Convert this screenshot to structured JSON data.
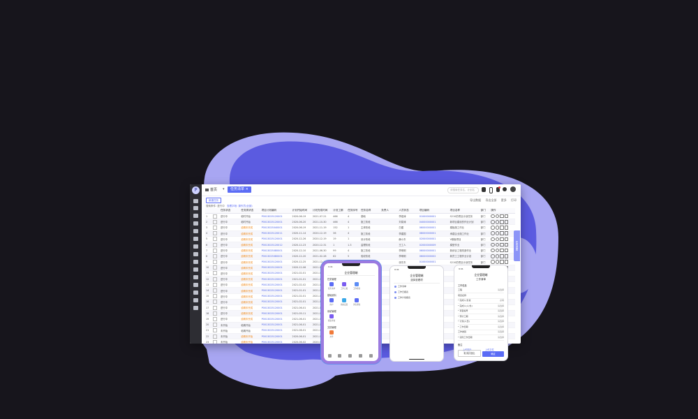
{
  "colors": {
    "accent": "#5b6cf5",
    "blob_dark": "#5b5be0",
    "blob_light": "#a8a6f2",
    "bg": "#17151c",
    "status_orange": "#f08a1a"
  },
  "desktop": {
    "home_tab": "首页",
    "active_tab": "任务清单 ×",
    "search_placeholder": "请搜索任务名、计划名",
    "toolbar_button": "新建任务",
    "toolbar_right": [
      "导出数据",
      "导出全部",
      "更多",
      "打印"
    ],
    "filter_text": "搜索条件: 进行中",
    "filter_text2": "查看字段: 操作员(全部)",
    "columns": [
      "",
      "",
      "任务状态",
      "任务类状态",
      "项目计划编码",
      "计划开始时间",
      "计划完成时间",
      "计划工期",
      "任务序号",
      "任务名称",
      "负责人",
      "人员状态",
      "项目编码",
      "项目名称",
      "部门",
      "操作"
    ],
    "rows": [
      [
        "1",
        "",
        "进行中",
        "临时开始",
        "P0013025120001",
        "2020-06-19",
        "2021-07-21",
        "466",
        "4",
        "基础",
        "",
        "李煜涛",
        "01000000001",
        "S210的项目计划任务",
        "部门"
      ],
      [
        "2",
        "",
        "进行中",
        "临时开始",
        "P0013025120001",
        "2020-06-20",
        "2021-10-30",
        "466",
        "4",
        "施工阶段",
        "",
        "刘易涛",
        "04000000001",
        "新项目建设的作业计划",
        "部门"
      ],
      [
        "3",
        "",
        "进行中",
        "逾期未完成",
        "P0013025040001",
        "2020-06-19",
        "2021-11-19",
        "152",
        "1",
        "主体阶段",
        "",
        "白建",
        "06000000001",
        "模板施工作业",
        "部门"
      ],
      [
        "4",
        "",
        "进行中",
        "逾期未完成",
        "P0013025120011",
        "2020-11-14",
        "2020-12-19",
        "36",
        "4",
        "施工阶段",
        "",
        "李建国",
        "08000000001",
        "承建企业施工作业",
        "部门"
      ],
      [
        "5",
        "",
        "进行中",
        "逾期未完成",
        "P0013025120001",
        "2020-12-26",
        "2020-12-19",
        "19",
        "1",
        "设计阶段",
        "",
        "薛小东",
        "02000000001",
        "V模板项目",
        "部门"
      ],
      [
        "6",
        "",
        "进行中",
        "逾期未完成",
        "P0013025120012",
        "2020-12-23",
        "2020-12-31",
        "1",
        "1.3",
        "监理阶段",
        "",
        "王工人",
        "02000000009",
        "模型作业",
        "部门"
      ],
      [
        "7",
        "",
        "进行中",
        "逾期未完成",
        "P0013025080001",
        "2020-12-10",
        "2021-06-30",
        "99",
        "4",
        "施工阶段",
        "",
        "李明明",
        "06000000001",
        "新综合工程改造作业",
        "部门"
      ],
      [
        "8",
        "",
        "进行中",
        "逾期未完成",
        "P0013025080001",
        "2020-12-20",
        "2021-02-28",
        "62",
        "5",
        "验收阶段",
        "",
        "李明明",
        "06000000002",
        "新员工工程作业计划",
        "部门"
      ],
      [
        "9",
        "",
        "进行中",
        "逾期未完成",
        "P0013025120001",
        "2020-12-25",
        "2021-12-31",
        "2",
        "3",
        "设计规划文档",
        "",
        "张东东",
        "01000000001",
        "S210的项目计划任务",
        "部门"
      ],
      [
        "10",
        "",
        "进行中",
        "逾期未完成",
        "P0013025120001",
        "2020-12-06",
        "2021-01-30",
        "",
        "",
        "",
        "",
        "",
        "",
        "",
        ""
      ],
      [
        "11",
        "",
        "进行中",
        "逾期未完成",
        "P0013025120001",
        "2021-02-01",
        "2021-04-30",
        "",
        "",
        "",
        "",
        "",
        "",
        "",
        ""
      ],
      [
        "12",
        "",
        "进行中",
        "逾期未完成",
        "P0013025120001",
        "2021-01-01",
        "2021-02-01",
        "",
        "",
        "",
        "",
        "",
        "",
        "",
        ""
      ],
      [
        "13",
        "",
        "进行中",
        "逾期未完成",
        "P0013025120001",
        "2021-02-02",
        "2021-02-03",
        "",
        "",
        "",
        "",
        "",
        "",
        "",
        ""
      ],
      [
        "14",
        "",
        "进行中",
        "逾期未完成",
        "P0013025120001",
        "2021-01-01",
        "2021-02-07",
        "",
        "",
        "",
        "",
        "",
        "",
        "",
        ""
      ],
      [
        "15",
        "",
        "进行中",
        "逾期未完成",
        "P0013025120001",
        "2021-02-01",
        "2021-04-03",
        "",
        "",
        "",
        "",
        "",
        "",
        "",
        ""
      ],
      [
        "16",
        "",
        "进行中",
        "逾期未完成",
        "P0013025120001",
        "2021-02-01",
        "2021-02-28",
        "",
        "",
        "",
        "",
        "",
        "",
        "",
        ""
      ],
      [
        "17",
        "",
        "进行中",
        "逾期未完成",
        "P0013025120001",
        "2021-06-01",
        "2021-06-03",
        "",
        "",
        "",
        "",
        "",
        "",
        "",
        ""
      ],
      [
        "18",
        "",
        "进行中",
        "逾期未完成",
        "P0013025120001",
        "2021-05-11",
        "2021-06-30",
        "",
        "",
        "",
        "",
        "",
        "",
        "",
        ""
      ],
      [
        "19",
        "",
        "进行中",
        "逾期未完成",
        "P0013025120001",
        "2021-06-01",
        "2021-06-15",
        "",
        "",
        "",
        "",
        "",
        "",
        "",
        ""
      ],
      [
        "20",
        "",
        "未开始",
        "临期开始",
        "P0013025120001",
        "2021-06-01",
        "2021-06-30",
        "",
        "",
        "",
        "",
        "",
        "",
        "",
        ""
      ],
      [
        "21",
        "",
        "未开始",
        "临期开始",
        "P0013025120001",
        "2021-06-01",
        "2021-07-31",
        "",
        "",
        "",
        "",
        "",
        "",
        "",
        ""
      ],
      [
        "22",
        "",
        "未开始",
        "逾期未开始",
        "P0013025120001",
        "2020-06-01",
        "2021-01-31",
        "",
        "",
        "",
        "",
        "",
        "",
        "",
        ""
      ],
      [
        "23",
        "",
        "未开始",
        "逾期未开始",
        "P0013025120001",
        "2020-06-02",
        "2020-06-03",
        "",
        "",
        "",
        "",
        "",
        "",
        "",
        ""
      ]
    ],
    "side_tab": "任务进度"
  },
  "phone1": {
    "status": "9:41",
    "title": "企业管理端",
    "sections": [
      "任务管理",
      "基础资料",
      "系统管理",
      "文档管理"
    ],
    "icons": [
      "任务清单",
      "工作日报",
      "工作检索",
      "用户",
      "系统设置",
      "消息通知",
      "报表查看",
      "文件"
    ]
  },
  "phone2": {
    "status": "9:41",
    "title": "企业管理端",
    "subtitle": "选择查看项",
    "items": [
      "工作清单",
      "工作日报表",
      "工作计划报表"
    ]
  },
  "phone3": {
    "status": "9:41",
    "title": "企业管理端",
    "subtitle": "工作清单",
    "section": "工作信息",
    "rows": [
      [
        "工程",
        "请选择"
      ],
      [
        "项目名称",
        ""
      ],
      [
        "* 完成人/负责",
        "必填"
      ],
      [
        "* 完成人(人/负)",
        "请选择"
      ],
      [
        "* 项目编号",
        "请选择"
      ],
      [
        "* 预计工期",
        "请选择"
      ],
      [
        "* 计划(人员)",
        "请选择"
      ],
      [
        "* 工作日期",
        "请选择"
      ],
      [
        "工作类别",
        "请选择"
      ],
      [
        "* 实际工作日期",
        "请选择"
      ]
    ],
    "note_label": "备注",
    "upload_labels": [
      "上传图片",
      "上传文件"
    ],
    "btn_cancel": "取消并退出",
    "btn_ok": "确定"
  }
}
